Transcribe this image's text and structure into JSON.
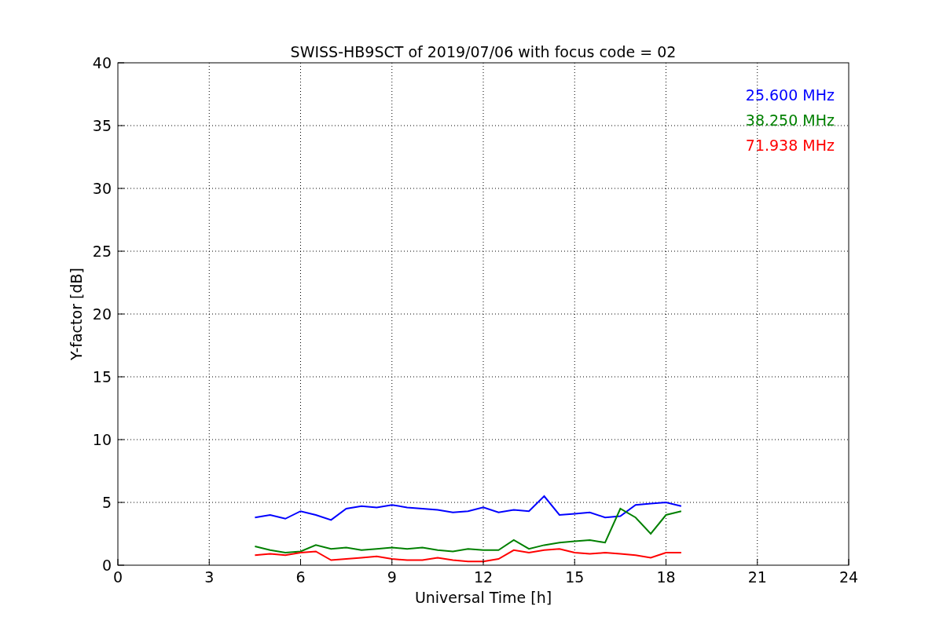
{
  "chart_data": {
    "type": "line",
    "title": "SWISS-HB9SCT of 2019/07/06 with focus code = 02",
    "xlabel": "Universal Time [h]",
    "ylabel": "Y-factor [dB]",
    "x": [
      4.5,
      5,
      5.5,
      6,
      6.5,
      7,
      7.5,
      8,
      8.5,
      9,
      9.5,
      10,
      10.5,
      11,
      11.5,
      12,
      12.5,
      13,
      13.5,
      14,
      14.5,
      15,
      15.5,
      16,
      16.5,
      17,
      17.5,
      18,
      18.5
    ],
    "series": [
      {
        "name": "25.600 MHz",
        "color": "#0000ff",
        "values": [
          3.8,
          4.0,
          3.7,
          4.3,
          4.0,
          3.6,
          4.5,
          4.7,
          4.6,
          4.8,
          4.6,
          4.5,
          4.4,
          4.2,
          4.3,
          4.6,
          4.2,
          4.4,
          4.3,
          5.5,
          4.0,
          4.1,
          4.2,
          3.8,
          3.9,
          4.8,
          4.9,
          5.0,
          4.7
        ]
      },
      {
        "name": "38.250 MHz",
        "color": "#008000",
        "values": [
          1.5,
          1.2,
          1.0,
          1.1,
          1.6,
          1.3,
          1.4,
          1.2,
          1.3,
          1.4,
          1.3,
          1.4,
          1.2,
          1.1,
          1.3,
          1.2,
          1.2,
          2.0,
          1.3,
          1.6,
          1.8,
          1.9,
          2.0,
          1.8,
          4.5,
          3.8,
          2.5,
          4.0,
          4.3
        ]
      },
      {
        "name": "71.938 MHz",
        "color": "#ff0000",
        "values": [
          0.8,
          0.9,
          0.8,
          1.0,
          1.1,
          0.4,
          0.5,
          0.6,
          0.7,
          0.5,
          0.4,
          0.4,
          0.6,
          0.4,
          0.3,
          0.3,
          0.5,
          1.2,
          1.0,
          1.2,
          1.3,
          1.0,
          0.9,
          1.0,
          0.9,
          0.8,
          0.6,
          1.0,
          1.0
        ]
      }
    ],
    "grid": true,
    "xlim": [
      0,
      24
    ],
    "ylim": [
      0,
      40
    ],
    "xticks": [
      0,
      3,
      6,
      9,
      12,
      15,
      18,
      21,
      24
    ],
    "yticks": [
      0,
      5,
      10,
      15,
      20,
      25,
      30,
      35,
      40
    ]
  }
}
